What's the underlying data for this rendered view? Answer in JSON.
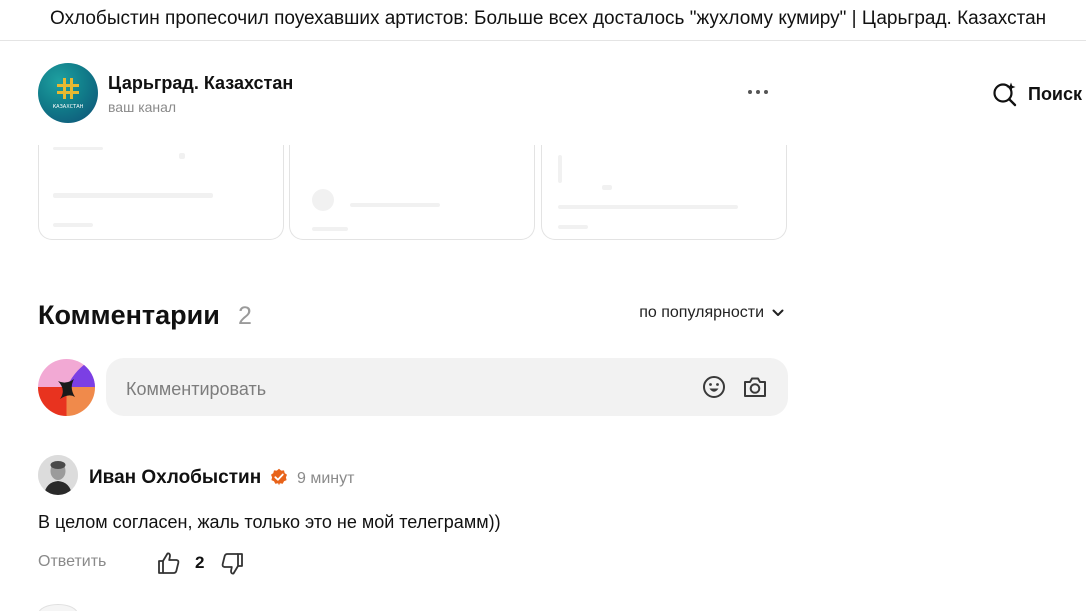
{
  "page": {
    "title": "Охлобыстин пропесочил поуехавших артистов: Больше всех досталось \"жухлому кумиру\" | Царьград. Казахстан"
  },
  "channel": {
    "name": "Царьград. Казахстан",
    "subtitle": "ваш канал",
    "logo_text": "КАЗАХСТАН",
    "more_icon": "more-dots-icon"
  },
  "search": {
    "label": "Поиск",
    "icon": "search-sparkle-icon"
  },
  "comments": {
    "title": "Комментарии",
    "count": "2",
    "sort_label": "по популярности",
    "sort_icon": "chevron-down-icon",
    "input_placeholder": "Комментировать",
    "emoji_icon": "emoji-icon",
    "photo_icon": "camera-icon",
    "items": [
      {
        "author": "Иван Охлобыстин",
        "verified": true,
        "time": "9 минут",
        "text": "В целом согласен, жаль только это не мой телеграмм))",
        "reply_label": "Ответить",
        "likes": "2"
      }
    ]
  },
  "colors": {
    "accent_verified": "#e8631a",
    "input_bg": "#f2f2f2",
    "muted_text": "#8a8a8a"
  }
}
